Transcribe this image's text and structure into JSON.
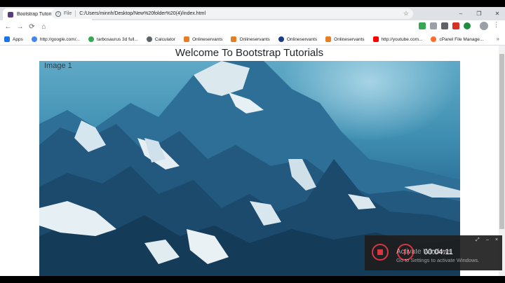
{
  "browser": {
    "tab_title": "Bootstrap Tutorials",
    "tab_close": "×",
    "new_tab": "+",
    "window_controls": [
      "–",
      "❐",
      "✕"
    ],
    "nav": {
      "back": "←",
      "forward": "→",
      "reload": "⟳",
      "home": "⌂"
    },
    "address": {
      "scheme_label": "File",
      "url": "C:/Users/minnh/Desktop/New%20folder%20(4)/index.html"
    },
    "bookmark_star": "☆",
    "menu": "⋮"
  },
  "bookmarks": {
    "items": [
      {
        "label": "Apps",
        "icon": "apps-icon",
        "color": "#1a73e8"
      },
      {
        "label": "http://google.com/...",
        "icon": "google-icon",
        "color": "#4285f4"
      },
      {
        "label": "tarbosaurus 3d full...",
        "icon": "google-icon",
        "color": "#34a853"
      },
      {
        "label": "Calculator",
        "icon": "calculator-icon",
        "color": "#5f6368"
      },
      {
        "label": "Onlineservants",
        "icon": "site-icon",
        "color": "#e67e22"
      },
      {
        "label": "Onlineservants",
        "icon": "site-icon",
        "color": "#e67e22"
      },
      {
        "label": "Onlineservants",
        "icon": "globe-icon",
        "color": "#1a3a8a"
      },
      {
        "label": "Onlineservants",
        "icon": "site-icon",
        "color": "#e67e22"
      },
      {
        "label": "http://youtube.com...",
        "icon": "youtube-icon",
        "color": "#ff0000"
      },
      {
        "label": "cPanel File Manage...",
        "icon": "cpanel-icon",
        "color": "#ff6c2c"
      }
    ],
    "more": "»"
  },
  "page": {
    "heading": "Welcome To Bootstrap Tutorials",
    "carousel_caption": "Image 1"
  },
  "recorder": {
    "time": "00:04:11",
    "expand": "⤢",
    "minimize": "–",
    "close": "×"
  },
  "watermark": {
    "title": "Activate Windows",
    "subtitle": "Go to Settings to activate Windows."
  }
}
